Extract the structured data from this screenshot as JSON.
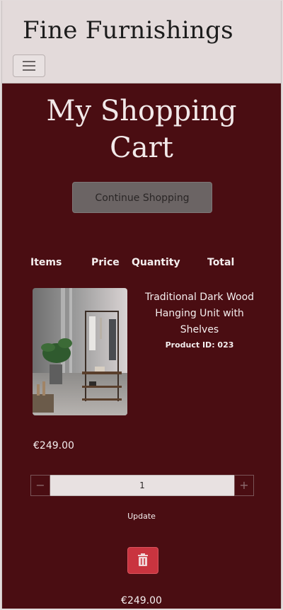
{
  "header": {
    "brand": "Fine Furnishings",
    "menu_icon": "hamburger-menu-icon"
  },
  "main": {
    "title": "My Shopping Cart",
    "continue_label": "Continue Shopping",
    "columns": [
      "Items",
      "Price",
      "Quantity",
      "Total"
    ]
  },
  "cart_item": {
    "name": "Traditional Dark Wood Hanging Unit with Shelves",
    "product_id": "Product ID: 023",
    "price": "€249.00",
    "quantity": "1",
    "decrement_label": "−",
    "increment_label": "+",
    "update_label": "Update",
    "delete_icon": "trash-icon",
    "total": "€249.00"
  },
  "colors": {
    "page_bg": "#4a0d12",
    "header_bg": "#e3dada",
    "delete_button": "#c9343f",
    "continue_button": "#6b6464"
  }
}
